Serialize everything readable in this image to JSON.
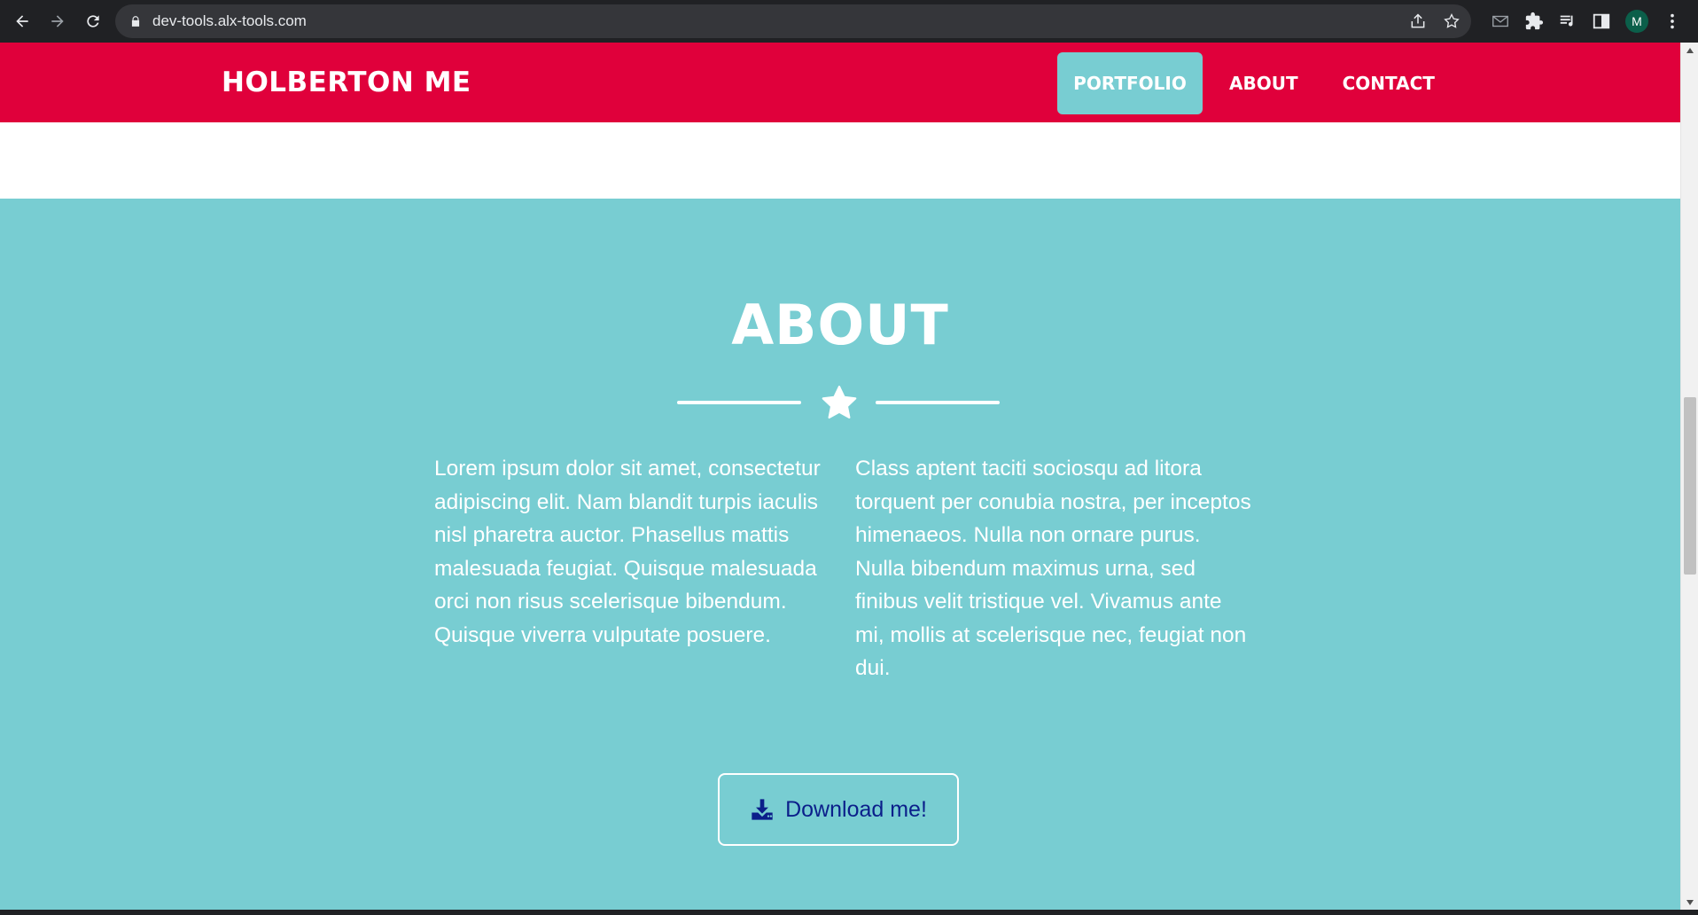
{
  "browser": {
    "url": "dev-tools.alx-tools.com",
    "profile_initial": "M"
  },
  "site": {
    "brand": "HOLBERTON ME",
    "nav": {
      "portfolio": "PORTFOLIO",
      "about": "ABOUT",
      "contact": "CONTACT"
    },
    "colors": {
      "navbar": "#e0003b",
      "accent": "#78cdd2",
      "button_text": "#0b1f8a"
    }
  },
  "about": {
    "title": "ABOUT",
    "paragraph_left": "Lorem ipsum dolor sit amet, consectetur adipiscing elit. Nam blandit turpis iaculis nisl pharetra auctor. Phasellus mattis malesuada feugiat. Quisque malesuada orci non risus scelerisque bibendum. Quisque viverra vulputate posuere.",
    "paragraph_right": "Class aptent taciti sociosqu ad litora torquent per conubia nostra, per inceptos himenaeos. Nulla non ornare purus. Nulla bibendum maximus urna, sed finibus velit tristique vel. Vivamus ante mi, mollis at scelerisque nec, feugiat non dui.",
    "download_label": "Download me!"
  }
}
